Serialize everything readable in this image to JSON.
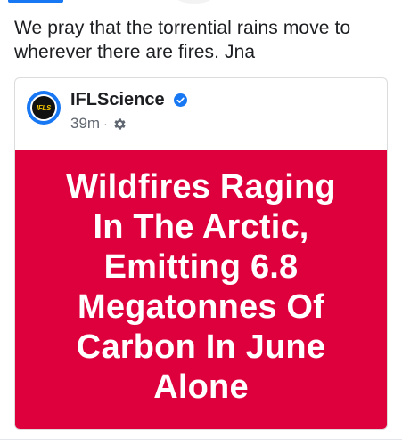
{
  "post": {
    "text": "We pray that the torrential rains move to wherever there are fires. Jna"
  },
  "shared_post": {
    "page_name": "IFLScience",
    "avatar_text": "IFLS",
    "timestamp": "39m",
    "separator": "·",
    "verified": true,
    "privacy_icon": "gear-icon",
    "image": {
      "background_color": "#de003c",
      "headline_lines": [
        "Wildfires Raging",
        "In The Arctic,",
        "Emitting 6.8",
        "Megatonnes Of",
        "Carbon In June",
        "Alone"
      ]
    }
  },
  "colors": {
    "accent": "#1877f2",
    "text_primary": "#1c1e21",
    "text_secondary": "#606770",
    "image_bg": "#de003c"
  }
}
